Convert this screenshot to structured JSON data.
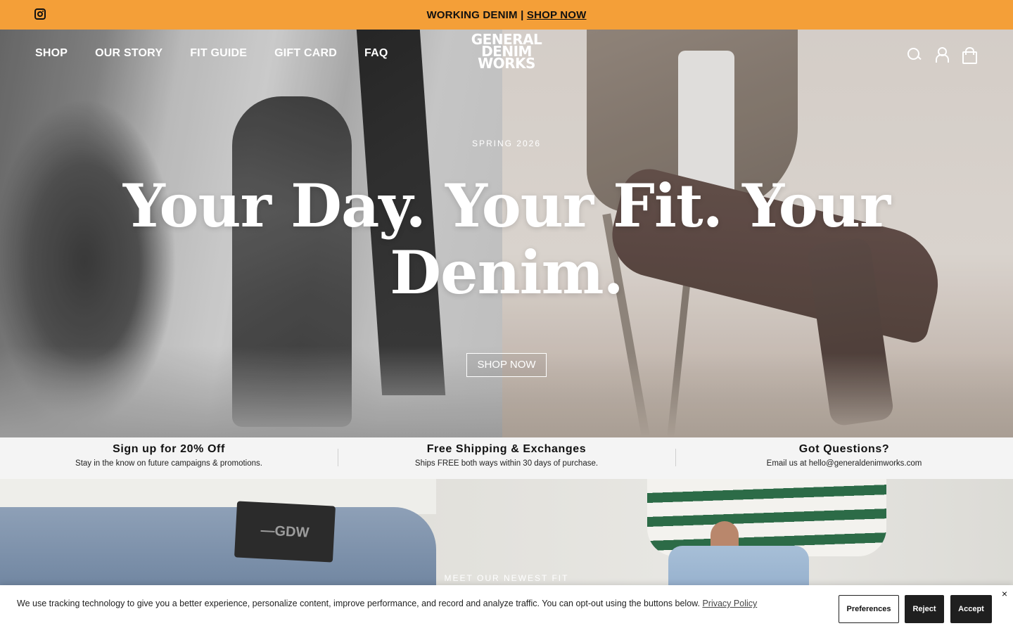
{
  "announcement": {
    "text": "WORKING DENIM |",
    "link": "SHOP NOW",
    "social_icon": "instagram-icon"
  },
  "nav": {
    "links": [
      "SHOP",
      "OUR STORY",
      "FIT GUIDE",
      "GIFT CARD",
      "FAQ"
    ],
    "logo_lines": [
      "GENERAL",
      "DENIM",
      "WORKS"
    ],
    "icons": [
      "search-icon",
      "account-icon",
      "bag-icon"
    ]
  },
  "hero": {
    "eyebrow": "SPRING 2026",
    "headline": "Your Day. Your Fit. Your Denim.",
    "cta": "SHOP NOW"
  },
  "perks": [
    {
      "title": "Sign up for 20% Off",
      "desc": "Stay in the know on future campaigns & promotions."
    },
    {
      "title": "Free Shipping & Exchanges",
      "desc": "Ships FREE both ways within 30 days of purchase."
    },
    {
      "title": "Got Questions?",
      "desc": "Email us at hello@generaldenimworks.com"
    }
  ],
  "feature": {
    "eyebrow": "MEET OUR NEWEST FIT",
    "patch_text": "—GDW"
  },
  "cookie": {
    "text": "We use tracking technology to give you a better experience, personalize content, improve performance, and record and analyze traffic. You can opt-out using the buttons below.",
    "link": "Privacy Policy",
    "preferences": "Preferences",
    "reject": "Reject",
    "accept": "Accept",
    "close": "×"
  },
  "colors": {
    "announcement_bg": "#f49f38",
    "perks_bg": "#f4f4f4",
    "button_dark": "#1f1f1f"
  }
}
